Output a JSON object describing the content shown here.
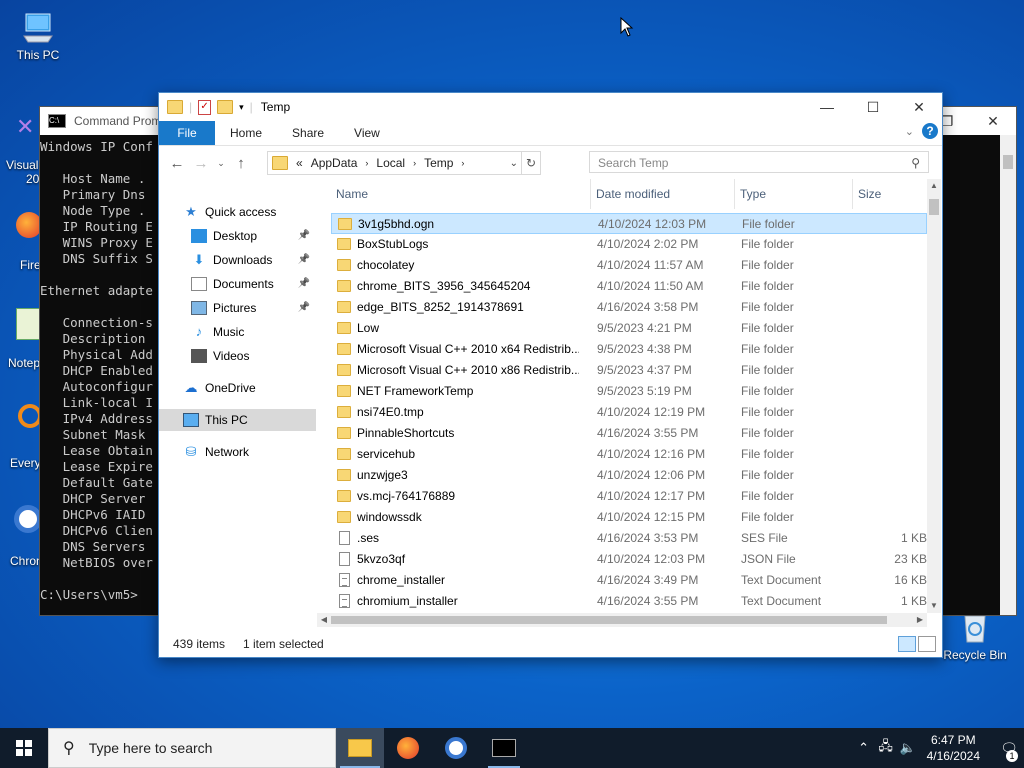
{
  "desktop": {
    "icons": [
      {
        "label": "This PC"
      },
      {
        "label": "Recycle Bin"
      }
    ],
    "partial_labels": [
      "Visual",
      "20",
      "Fire",
      "Notep",
      "Every",
      "Chron"
    ]
  },
  "cmd": {
    "title": "Command Prom",
    "lines": [
      "Windows IP Conf",
      "",
      "   Host Name .",
      "   Primary Dns",
      "   Node Type .",
      "   IP Routing E",
      "   WINS Proxy E",
      "   DNS Suffix S",
      "",
      "Ethernet adapte",
      "",
      "   Connection-s",
      "   Description",
      "   Physical Add",
      "   DHCP Enabled",
      "   Autoconfigur",
      "   Link-local I",
      "   IPv4 Address",
      "   Subnet Mask",
      "   Lease Obtain",
      "   Lease Expire",
      "   Default Gate",
      "   DHCP Server",
      "   DHCPv6 IAID",
      "   DHCPv6 Clien",
      "   DNS Servers",
      "   NetBIOS over",
      "",
      "C:\\Users\\vm5>"
    ]
  },
  "explorer": {
    "title": "Temp",
    "ribbon": {
      "file": "File",
      "tabs": [
        "Home",
        "Share",
        "View"
      ]
    },
    "address": {
      "prefix": "«",
      "segments": [
        "AppData",
        "Local",
        "Temp"
      ]
    },
    "search_placeholder": "Search Temp",
    "nav": [
      {
        "label": "Quick access",
        "pinned": false
      },
      {
        "label": "Desktop",
        "pinned": true
      },
      {
        "label": "Downloads",
        "pinned": true
      },
      {
        "label": "Documents",
        "pinned": true
      },
      {
        "label": "Pictures",
        "pinned": true
      },
      {
        "label": "Music",
        "pinned": false
      },
      {
        "label": "Videos",
        "pinned": false
      },
      {
        "label": "OneDrive",
        "pinned": false
      },
      {
        "label": "This PC",
        "pinned": false
      },
      {
        "label": "Network",
        "pinned": false
      }
    ],
    "columns": {
      "name": "Name",
      "date": "Date modified",
      "type": "Type",
      "size": "Size"
    },
    "files": [
      {
        "name": "3v1g5bhd.ogn",
        "date": "4/10/2024 12:03 PM",
        "type": "File folder",
        "size": "",
        "kind": "folder",
        "selected": true
      },
      {
        "name": "BoxStubLogs",
        "date": "4/10/2024 2:02 PM",
        "type": "File folder",
        "size": "",
        "kind": "folder"
      },
      {
        "name": "chocolatey",
        "date": "4/10/2024 11:57 AM",
        "type": "File folder",
        "size": "",
        "kind": "folder"
      },
      {
        "name": "chrome_BITS_3956_345645204",
        "date": "4/10/2024 11:50 AM",
        "type": "File folder",
        "size": "",
        "kind": "folder"
      },
      {
        "name": "edge_BITS_8252_1914378691",
        "date": "4/16/2024 3:58 PM",
        "type": "File folder",
        "size": "",
        "kind": "folder"
      },
      {
        "name": "Low",
        "date": "9/5/2023 4:21 PM",
        "type": "File folder",
        "size": "",
        "kind": "folder"
      },
      {
        "name": "Microsoft Visual C++ 2010  x64 Redistrib...",
        "date": "9/5/2023 4:38 PM",
        "type": "File folder",
        "size": "",
        "kind": "folder"
      },
      {
        "name": "Microsoft Visual C++ 2010  x86 Redistrib...",
        "date": "9/5/2023 4:37 PM",
        "type": "File folder",
        "size": "",
        "kind": "folder"
      },
      {
        "name": "NET FrameworkTemp",
        "date": "9/5/2023 5:19 PM",
        "type": "File folder",
        "size": "",
        "kind": "folder"
      },
      {
        "name": "nsi74E0.tmp",
        "date": "4/10/2024 12:19 PM",
        "type": "File folder",
        "size": "",
        "kind": "folder"
      },
      {
        "name": "PinnableShortcuts",
        "date": "4/16/2024 3:55 PM",
        "type": "File folder",
        "size": "",
        "kind": "folder"
      },
      {
        "name": "servicehub",
        "date": "4/10/2024 12:16 PM",
        "type": "File folder",
        "size": "",
        "kind": "folder"
      },
      {
        "name": "unzwjge3",
        "date": "4/10/2024 12:06 PM",
        "type": "File folder",
        "size": "",
        "kind": "folder"
      },
      {
        "name": "vs.mcj-764176889",
        "date": "4/10/2024 12:17 PM",
        "type": "File folder",
        "size": "",
        "kind": "folder"
      },
      {
        "name": "windowssdk",
        "date": "4/10/2024 12:15 PM",
        "type": "File folder",
        "size": "",
        "kind": "folder"
      },
      {
        "name": ".ses",
        "date": "4/16/2024 3:53 PM",
        "type": "SES File",
        "size": "1 KB",
        "kind": "file"
      },
      {
        "name": "5kvzo3qf",
        "date": "4/10/2024 12:03 PM",
        "type": "JSON File",
        "size": "23 KB",
        "kind": "json"
      },
      {
        "name": "chrome_installer",
        "date": "4/16/2024 3:49 PM",
        "type": "Text Document",
        "size": "16 KB",
        "kind": "text"
      },
      {
        "name": "chromium_installer",
        "date": "4/16/2024 3:55 PM",
        "type": "Text Document",
        "size": "1 KB",
        "kind": "text"
      }
    ],
    "status": {
      "items": "439 items",
      "selected": "1 item selected"
    }
  },
  "taskbar": {
    "search_placeholder": "Type here to search",
    "time": "6:47 PM",
    "date": "4/16/2024",
    "notifications": "1"
  },
  "colors": {
    "accent": "#1979ca",
    "selection": "#cce8ff",
    "folder": "#f8d775"
  }
}
